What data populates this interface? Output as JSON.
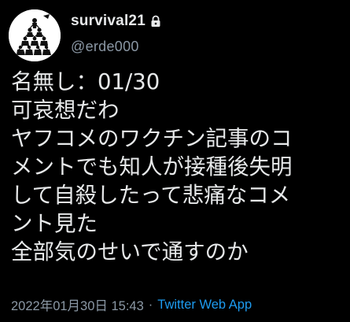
{
  "author": {
    "display_name": "survival21",
    "handle": "@erde000",
    "protected": true
  },
  "tweet": {
    "lines": [
      "名無し：01/30",
      "可哀想だわ",
      "ヤフコメのワクチン記事のコ",
      "メントでも知人が接種後失明",
      "して自殺したって悲痛なコメ",
      "ント見た",
      "全部気のせいで通すのか"
    ],
    "timestamp": "2022年01月30日 15:43",
    "separator": "·",
    "source": "Twitter Web App"
  },
  "icons": {
    "avatar": "avatar-image",
    "lock": "lock-icon"
  },
  "colors": {
    "background": "#000000",
    "text_primary": "#e7e9ea",
    "text_secondary": "#8b98a5",
    "link": "#1d9bf0"
  }
}
